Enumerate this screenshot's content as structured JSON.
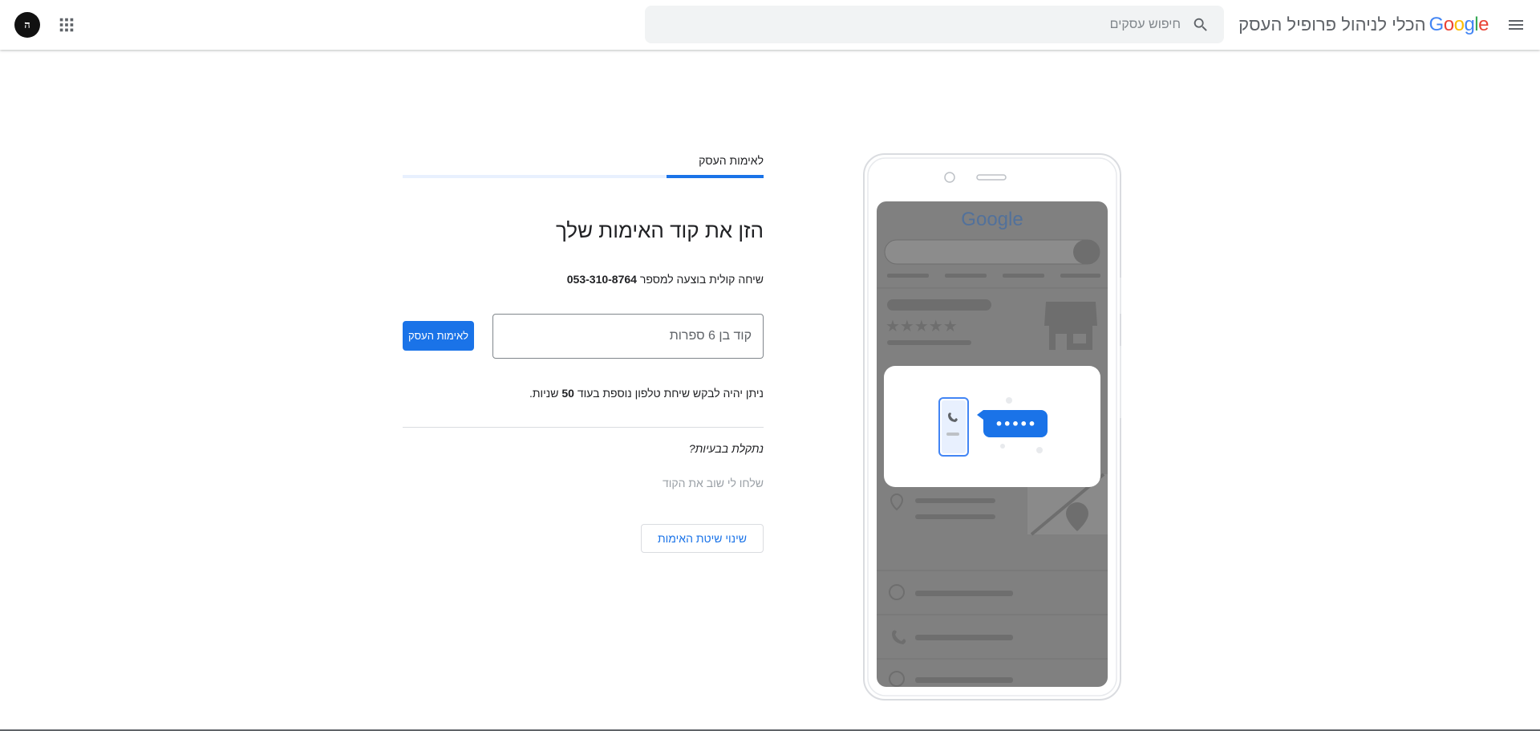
{
  "header": {
    "menu_icon": "hamburger-menu-icon",
    "brand_logo": "Google",
    "product_title": "הכלי לניהול פרופיל העסק",
    "search": {
      "placeholder": "חיפוש עסקים",
      "icon": "search-icon"
    },
    "apps_icon": "apps-grid-icon",
    "avatar_initials": "ה"
  },
  "verification": {
    "step_label": "לאימות העסק",
    "progress_percent": 27,
    "heading": "הזן את קוד האימות שלך",
    "call_info_prefix": "שיחה קולית בוצעה למספר",
    "phone_number": "053-310-8764",
    "code_placeholder": "קוד בן 6 ספרות",
    "verify_button_label": "לאימות העסק",
    "resend_prefix": "ניתן יהיה לבקש שיחת טלפון נוספת בעוד",
    "resend_seconds": "50",
    "resend_suffix": "שניות.",
    "trouble_label": "נתקלת בבעיות?",
    "resend_code_link": "שלחו לי שוב את הקוד",
    "change_method_button": "שינוי שיטת האימות"
  },
  "illustration": {
    "logo_text": "Google",
    "code_bubble": "•••••",
    "colors": {
      "accent": "#1a73e8",
      "dim": "#808080"
    }
  }
}
